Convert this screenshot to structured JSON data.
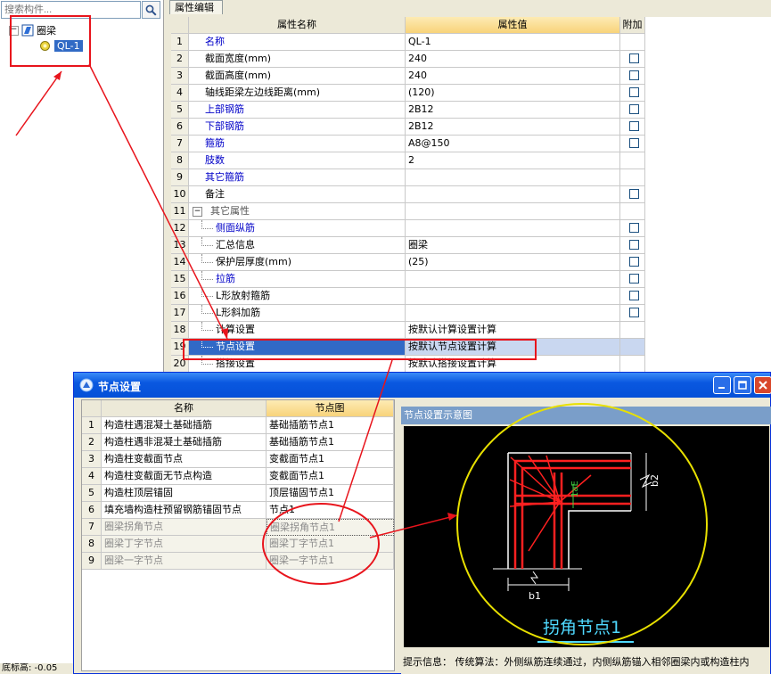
{
  "search": {
    "placeholder": "搜索构件..."
  },
  "tree": {
    "root_label": "圈梁",
    "child_label": "QL-1"
  },
  "status": {
    "bottom_text": "底标高: -0.05"
  },
  "property_panel": {
    "tab_label": "属性编辑",
    "columns": {
      "name": "属性名称",
      "value": "属性值",
      "extra": "附加"
    },
    "rows": [
      {
        "num": "1",
        "name": "名称",
        "value": "QL-1",
        "style": "blue",
        "indent": 0,
        "check": false
      },
      {
        "num": "2",
        "name": "截面宽度(mm)",
        "value": "240",
        "style": "normal",
        "indent": 0,
        "check": true
      },
      {
        "num": "3",
        "name": "截面高度(mm)",
        "value": "240",
        "style": "normal",
        "indent": 0,
        "check": true
      },
      {
        "num": "4",
        "name": "轴线距梁左边线距离(mm)",
        "value": "(120)",
        "style": "normal",
        "indent": 0,
        "check": true
      },
      {
        "num": "5",
        "name": "上部钢筋",
        "value": "2B12",
        "style": "blue",
        "indent": 0,
        "check": true
      },
      {
        "num": "6",
        "name": "下部钢筋",
        "value": "2B12",
        "style": "blue",
        "indent": 0,
        "check": true
      },
      {
        "num": "7",
        "name": "箍筋",
        "value": "A8@150",
        "style": "blue",
        "indent": 0,
        "check": true
      },
      {
        "num": "8",
        "name": "肢数",
        "value": "2",
        "style": "blue",
        "indent": 0,
        "check": false
      },
      {
        "num": "9",
        "name": "其它箍筋",
        "value": "",
        "style": "blue",
        "indent": 0,
        "check": false
      },
      {
        "num": "10",
        "name": "备注",
        "value": "",
        "style": "normal",
        "indent": 0,
        "check": true
      },
      {
        "num": "11",
        "name": "其它属性",
        "value": "",
        "style": "group",
        "indent": 0,
        "check": false
      },
      {
        "num": "12",
        "name": "侧面纵筋",
        "value": "",
        "style": "blue",
        "indent": 1,
        "check": true
      },
      {
        "num": "13",
        "name": "汇总信息",
        "value": "圈梁",
        "style": "normal",
        "indent": 1,
        "check": true
      },
      {
        "num": "14",
        "name": "保护层厚度(mm)",
        "value": "(25)",
        "style": "normal",
        "indent": 1,
        "check": true
      },
      {
        "num": "15",
        "name": "拉筋",
        "value": "",
        "style": "blue",
        "indent": 1,
        "check": true
      },
      {
        "num": "16",
        "name": "L形放射箍筋",
        "value": "",
        "style": "normal",
        "indent": 1,
        "check": true
      },
      {
        "num": "17",
        "name": "L形斜加筋",
        "value": "",
        "style": "normal",
        "indent": 1,
        "check": true
      },
      {
        "num": "18",
        "name": "计算设置",
        "value": "按默认计算设置计算",
        "style": "normal",
        "indent": 1,
        "check": false
      },
      {
        "num": "19",
        "name": "节点设置",
        "value": "按默认节点设置计算",
        "style": "selected",
        "indent": 1,
        "check": false
      },
      {
        "num": "20",
        "name": "搭接设置",
        "value": "按默认搭接设置计算",
        "style": "normal",
        "indent": 1,
        "check": false
      }
    ]
  },
  "node_dialog": {
    "title": "节点设置",
    "columns": {
      "name": "名称",
      "node": "节点图"
    },
    "rows": [
      {
        "num": "1",
        "name": "构造柱遇混凝土基础插筋",
        "node": "基础插筋节点1",
        "muted": false
      },
      {
        "num": "2",
        "name": "构造柱遇非混凝土基础插筋",
        "node": "基础插筋节点1",
        "muted": false
      },
      {
        "num": "3",
        "name": "构造柱变截面节点",
        "node": "变截面节点1",
        "muted": false
      },
      {
        "num": "4",
        "name": "构造柱变截面无节点构造",
        "node": "变截面节点1",
        "muted": false
      },
      {
        "num": "5",
        "name": "构造柱顶层锚固",
        "node": "顶层锚固节点1",
        "muted": false
      },
      {
        "num": "6",
        "name": "填充墙构造柱预留钢筋锚固节点",
        "node": "节点1",
        "muted": false
      },
      {
        "num": "7",
        "name": "圈梁拐角节点",
        "node": "圈梁拐角节点1",
        "muted": true
      },
      {
        "num": "8",
        "name": "圈梁丁字节点",
        "node": "圈梁丁字节点1",
        "muted": true
      },
      {
        "num": "9",
        "name": "圈梁一字节点",
        "node": "圈梁一字节点1",
        "muted": true
      }
    ],
    "preview": {
      "title": "节点设置示意图",
      "caption": "拐角节点1",
      "dim_b1": "b1",
      "dim_b2": "b2",
      "dim_lae": "1aE"
    },
    "hint": "提示信息：  传统算法：外侧纵筋连续通过，内侧纵筋锚入相邻圈梁内或构造柱内"
  },
  "colors": {
    "annotation_red": "#e8141c",
    "highlight_yellow": "#e8e000",
    "rebar_red": "#ff2020",
    "caption_cyan": "#4fd9ff",
    "selection_blue": "#3169c6",
    "title_bar_blue": "#0a58e0"
  }
}
